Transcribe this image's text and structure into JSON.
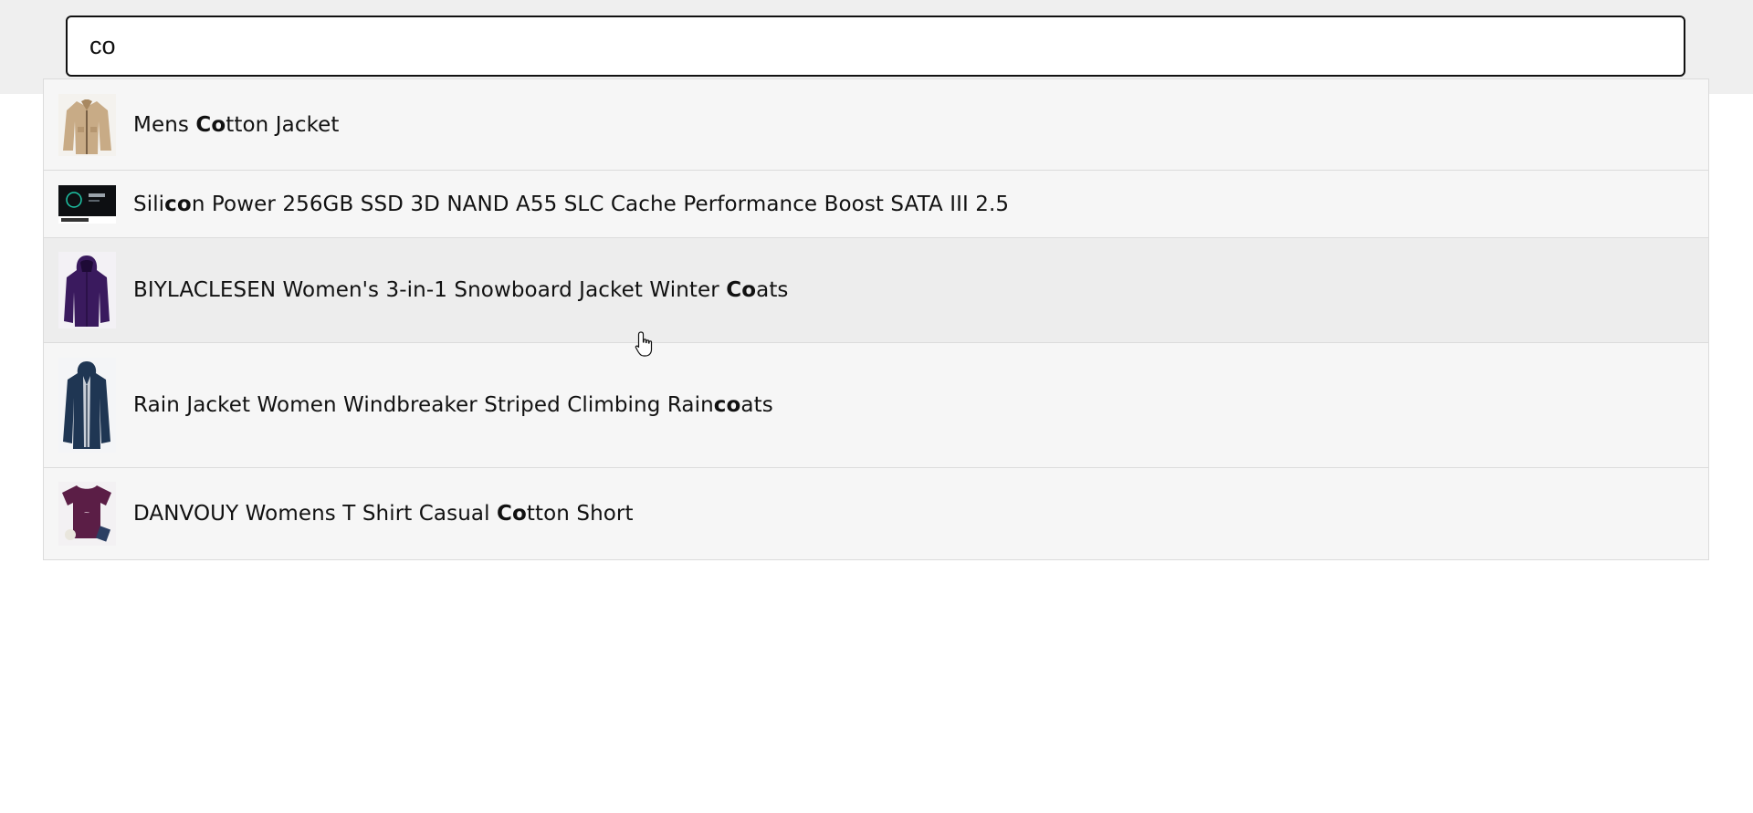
{
  "search": {
    "value": "co",
    "placeholder": ""
  },
  "results": [
    {
      "thumbnail": "tan-cotton-jacket-photo",
      "prefix": "Mens ",
      "match": "Co",
      "suffix": "tton Jacket"
    },
    {
      "thumbnail": "ssd-drive-package-photo",
      "prefix": "Sili",
      "match": "co",
      "suffix": "n Power 256GB SSD 3D NAND A55 SLC Cache Performance Boost SATA III 2.5"
    },
    {
      "thumbnail": "purple-hooded-coat-photo",
      "prefix": "BIYLACLESEN Women's 3-in-1 Snowboard Jacket Winter ",
      "match": "Co",
      "suffix": "ats"
    },
    {
      "thumbnail": "navy-raincoat-photo",
      "prefix": "Rain Jacket Women Windbreaker Striped Climbing Rain",
      "match": "co",
      "suffix": "ats"
    },
    {
      "thumbnail": "purple-tshirt-photo",
      "prefix": "DANVOUY Womens T Shirt Casual ",
      "match": "Co",
      "suffix": "tton Short"
    }
  ],
  "colors": {
    "top_band": "#efefef",
    "dropdown_bg": "#f6f6f6",
    "hover_bg": "#ededed",
    "border": "#dcdcdc"
  }
}
